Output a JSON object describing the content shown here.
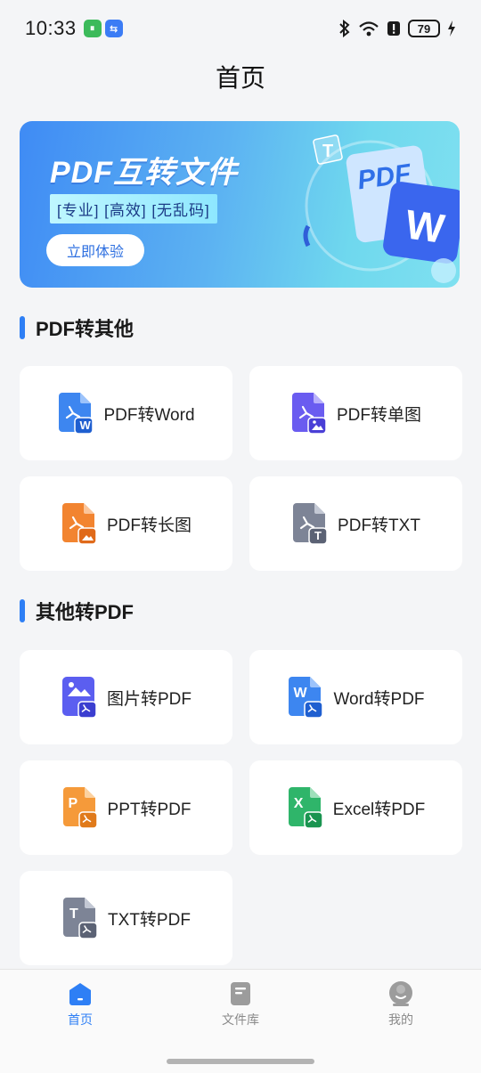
{
  "status_bar": {
    "time": "10:33",
    "battery": "79"
  },
  "header": {
    "title": "首页"
  },
  "banner": {
    "title": "PDF互转文件",
    "tags": "[专业] [高效] [无乱码]",
    "button_label": "立即体验",
    "art_pdf_text": "PDF",
    "art_word_letter": "W",
    "art_t_letter": "T"
  },
  "sections": [
    {
      "title": "PDF转其他",
      "items": [
        {
          "label": "PDF转Word",
          "icon": "pdf-to-word-icon",
          "letter": "W"
        },
        {
          "label": "PDF转单图",
          "icon": "pdf-to-image-icon",
          "letter": ""
        },
        {
          "label": "PDF转长图",
          "icon": "pdf-to-long-image-icon",
          "letter": ""
        },
        {
          "label": "PDF转TXT",
          "icon": "pdf-to-txt-icon",
          "letter": "T"
        }
      ]
    },
    {
      "title": "其他转PDF",
      "items": [
        {
          "label": "图片转PDF",
          "icon": "image-to-pdf-icon",
          "letter": ""
        },
        {
          "label": "Word转PDF",
          "icon": "word-to-pdf-icon",
          "letter": "W"
        },
        {
          "label": "PPT转PDF",
          "icon": "ppt-to-pdf-icon",
          "letter": "P"
        },
        {
          "label": "Excel转PDF",
          "icon": "excel-to-pdf-icon",
          "letter": "X"
        },
        {
          "label": "TXT转PDF",
          "icon": "txt-to-pdf-icon",
          "letter": "T"
        }
      ]
    }
  ],
  "tabs": [
    {
      "label": "首页",
      "icon": "home-icon",
      "active": true
    },
    {
      "label": "文件库",
      "icon": "file-library-icon",
      "active": false
    },
    {
      "label": "我的",
      "icon": "profile-icon",
      "active": false
    }
  ],
  "colors": {
    "accent": "#2e7ff5",
    "word": "#3d86f0",
    "image": "#5b5ef0",
    "long_image": "#f28430",
    "txt": "#6d7485",
    "ppt": "#f59a3a",
    "excel": "#2fb56a"
  }
}
